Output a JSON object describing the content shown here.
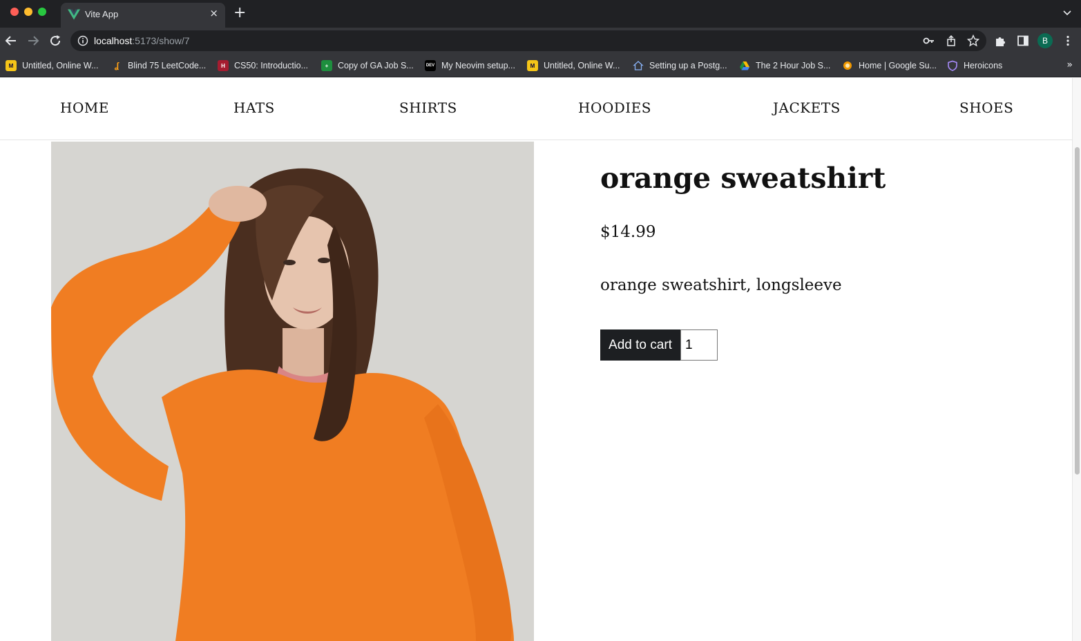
{
  "browser": {
    "tab": {
      "title": "Vite App",
      "favicon": "vue-logo-icon",
      "close_glyph": "×"
    },
    "new_tab_glyph": "+",
    "address": {
      "host": "localhost",
      "path": ":5173/show/7"
    },
    "profile_initial": "B",
    "bookmarks": [
      {
        "label": "Untitled, Online W...",
        "icon": "miro-icon",
        "color": "#f5c518"
      },
      {
        "label": "Blind 75 LeetCode...",
        "icon": "leetcode-icon",
        "color": "#35363a"
      },
      {
        "label": "CS50: Introductio...",
        "icon": "harvard-icon",
        "color": "#a51c30"
      },
      {
        "label": "Copy of GA Job S...",
        "icon": "sheets-icon",
        "color": "#1e8e3e"
      },
      {
        "label": "My Neovim setup...",
        "icon": "dev-icon",
        "color": "#000000"
      },
      {
        "label": "Untitled, Online W...",
        "icon": "miro-icon",
        "color": "#f5c518"
      },
      {
        "label": "Setting up a Postg...",
        "icon": "house-icon",
        "color": "#35363a"
      },
      {
        "label": "The 2 Hour Job S...",
        "icon": "google-drive-icon",
        "color": "#35363a"
      },
      {
        "label": "Home | Google Su...",
        "icon": "google-support-icon",
        "color": "#f29900"
      },
      {
        "label": "Heroicons",
        "icon": "heroicons-icon",
        "color": "#35363a"
      }
    ],
    "bookmarks_more_glyph": "»"
  },
  "nav": {
    "items": [
      "HOME",
      "HATS",
      "SHIRTS",
      "HOODIES",
      "JACKETS",
      "SHOES"
    ]
  },
  "product": {
    "title": "orange sweatshirt",
    "price": "$14.99",
    "description": "orange sweatshirt, longsleeve",
    "add_to_cart_label": "Add to cart",
    "quantity": "1",
    "image_colors": {
      "background": "#d6d5d1",
      "sweatshirt": "#f07d22",
      "hair": "#4a2e1f",
      "skin": "#e6c4ae"
    }
  }
}
